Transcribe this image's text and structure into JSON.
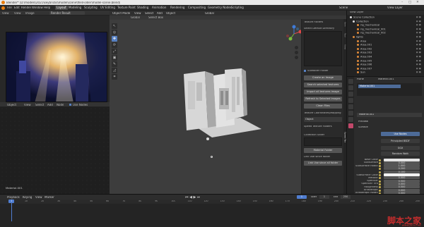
{
  "window": {
    "title": "Blender* [D:\\models\\2021\\keybricks\\model\\scene\\file\\Folder\\model-scene.blend]",
    "controls": [
      "–",
      "□",
      "✕"
    ]
  },
  "menu": {
    "items": [
      "File",
      "Edit",
      "Render",
      "Window",
      "Help"
    ],
    "workspaces": [
      "Layout",
      "Modeling",
      "Sculpting",
      "UV Editing",
      "Texture Paint",
      "Shading",
      "Animation",
      "Rendering",
      "Compositing",
      "Geometry Nodes",
      "Scripting"
    ],
    "active_workspace": "Layout",
    "scene_label": "Scene",
    "view_layer_label": "View Layer"
  },
  "image_editor": {
    "header": [
      "View",
      "View",
      "Image"
    ],
    "image_name": "Render Result"
  },
  "node_editor": {
    "header": [
      "Object",
      "View",
      "Select",
      "Add",
      "Node",
      "Use Nodes"
    ],
    "material_label": "Material.001"
  },
  "viewport": {
    "header": [
      "Object Mode",
      "View",
      "Select",
      "Add",
      "Object"
    ],
    "orientation": "Global",
    "overlay_header": [
      "Global",
      "Select Box"
    ],
    "tools": [
      "↖",
      "◎",
      "✥",
      "⟳",
      "⤢",
      "▣",
      "✎",
      "◿",
      "⌗"
    ],
    "active_tool_index": 2
  },
  "npanel": {
    "section1": "Texture Folders",
    "section1_label": "Select Default Directory",
    "checkbox_label": "Subfolder Folder",
    "buttons": [
      "Create an Image",
      "Search selected textures",
      "Import all textures image",
      "Refresh to Selected images",
      "Clean Files"
    ],
    "section2": "Texture Coordinates/Mapping",
    "mapping_value": "Object",
    "section3": "Speed Texture Folders",
    "sub_label": "Collection Slider",
    "button_a": "Material Folder",
    "link_label": "Link Use since folder",
    "button_b": "Link Use since all folder",
    "tabs": [
      "Item",
      "Tool",
      "View",
      "Speed Tex"
    ]
  },
  "outliner": {
    "header": "View Layer",
    "rows": [
      "Scene Collection",
      "Collection",
      "rig_mechanical",
      "rig_mechanical_001",
      "rig_mechanical_002",
      "lights",
      "Area",
      "Area.001",
      "Area.002",
      "Area.003",
      "Area.004",
      "Area.005",
      "Area.006",
      "Area.007",
      "Sun"
    ]
  },
  "properties": {
    "object_name": "Plane",
    "material_name": "Material.001",
    "slot_label": "Material.001",
    "section_preview": "Preview",
    "section_surface": "Surface",
    "use_nodes": "Use Nodes",
    "surface_value": "Principled BSDF",
    "distribution": "GGX",
    "subsurface_method": "Random Walk",
    "fields": [
      {
        "label": "Base Color",
        "value": ""
      },
      {
        "label": "Subsurface",
        "value": "0.000"
      },
      {
        "label": "Subsurface Radius",
        "value": "1.000"
      },
      {
        "label": "",
        "value": "0.200"
      },
      {
        "label": "",
        "value": "0.100"
      },
      {
        "label": "Subsurface Color",
        "value": ""
      },
      {
        "label": "Metallic",
        "value": "0.000"
      },
      {
        "label": "Specular",
        "value": "0.500"
      },
      {
        "label": "Specular Tint",
        "value": "0.000"
      },
      {
        "label": "Roughness",
        "value": "0.500"
      },
      {
        "label": "Anisotropic",
        "value": "0.000"
      },
      {
        "label": "Anisotropic Rotation",
        "value": "0.000"
      }
    ]
  },
  "timeline": {
    "header": [
      "Playback",
      "Keying",
      "View",
      "Marker"
    ],
    "frames": [
      "0",
      "10",
      "20",
      "30",
      "40",
      "50",
      "60",
      "70",
      "80",
      "90",
      "100",
      "110",
      "120",
      "130",
      "140",
      "150",
      "160",
      "170",
      "180",
      "190",
      "200",
      "210",
      "220",
      "230",
      "240",
      "250"
    ],
    "current_frame": "1",
    "start_label": "Start",
    "start": "1",
    "end_label": "End",
    "end": "250"
  },
  "watermark": {
    "text": "脚本之家",
    "url": "www.jb51.net"
  },
  "colors": {
    "accent": "#5680c2",
    "dark_bg": "#1d1d1d",
    "viewport_bg": "#3d3d3d",
    "panel_bg": "#2c2c2c",
    "watermark": "#c42d2d"
  }
}
